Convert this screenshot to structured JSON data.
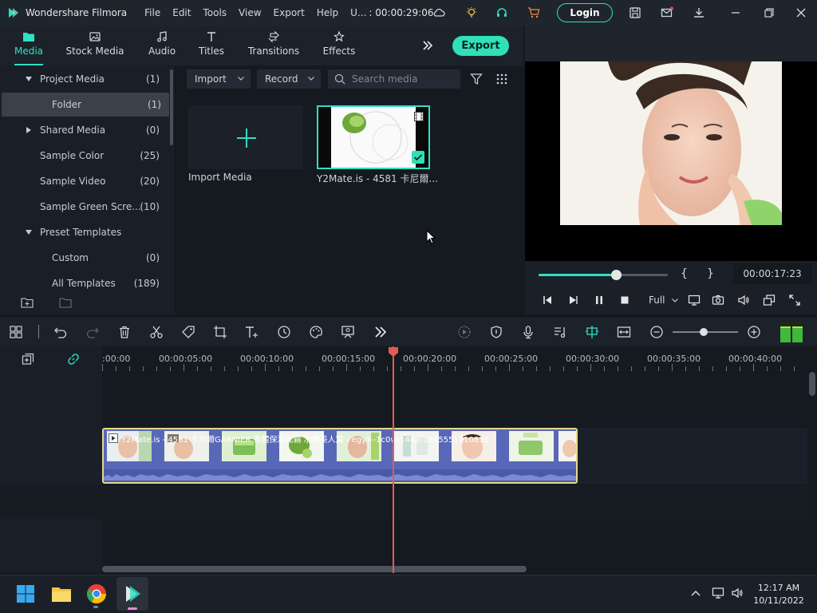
{
  "titlebar": {
    "app_name": "Wondershare Filmora",
    "menus": [
      "File",
      "Edit",
      "Tools",
      "View",
      "Export",
      "Help",
      "U..."
    ],
    "timecode": ": 00:00:29:06",
    "login_label": "Login"
  },
  "tabs": {
    "items": [
      {
        "label": "Media",
        "icon": "media-folder-icon"
      },
      {
        "label": "Stock Media",
        "icon": "stock-media-icon"
      },
      {
        "label": "Audio",
        "icon": "music-note-icon"
      },
      {
        "label": "Titles",
        "icon": "text-icon"
      },
      {
        "label": "Transitions",
        "icon": "transitions-icon"
      },
      {
        "label": "Effects",
        "icon": "effects-icon"
      }
    ],
    "export_label": "Export",
    "accent": "#2fe0c2"
  },
  "sidebar": {
    "items": [
      {
        "label": "Project Media",
        "count": "(1)"
      },
      {
        "label": "Folder",
        "count": "(1)"
      },
      {
        "label": "Shared Media",
        "count": "(0)"
      },
      {
        "label": "Sample Color",
        "count": "(25)"
      },
      {
        "label": "Sample Video",
        "count": "(20)"
      },
      {
        "label": "Sample Green Scre...",
        "count": "(10)"
      },
      {
        "label": "Preset Templates",
        "count": ""
      },
      {
        "label": "Custom",
        "count": "(0)"
      },
      {
        "label": "All Templates",
        "count": "(189)"
      }
    ]
  },
  "media": {
    "import_label": "Import",
    "record_label": "Record",
    "search_placeholder": "Search media",
    "import_tile_label": "Import Media",
    "video_tile_label": "Y2Mate.is - 4581 卡尼爾..."
  },
  "preview": {
    "timecode": "00:00:17:23",
    "progress": 0.6,
    "quality": "Full",
    "brace_open": "{",
    "brace_close": "}"
  },
  "timeline": {
    "ruler_labels": [
      ":00:00",
      "00:00:05:00",
      "00:00:10:00",
      "00:00:15:00",
      "00:00:20:00",
      "00:00:25:00",
      "00:00:30:00",
      "00:00:35:00",
      "00:00:40:00"
    ],
    "clip_title": "Y2Mate.is - 4581 卡尼爾GARNIER 香體保濕乳霜 水嫩美人篇 - egyY--1c0w-144p-1665551710836",
    "video_track_num": "1",
    "audio_track_num": "1",
    "zoom": 0.48
  },
  "taskbar": {
    "time": "12:17 AM",
    "date": "10/11/2022"
  }
}
